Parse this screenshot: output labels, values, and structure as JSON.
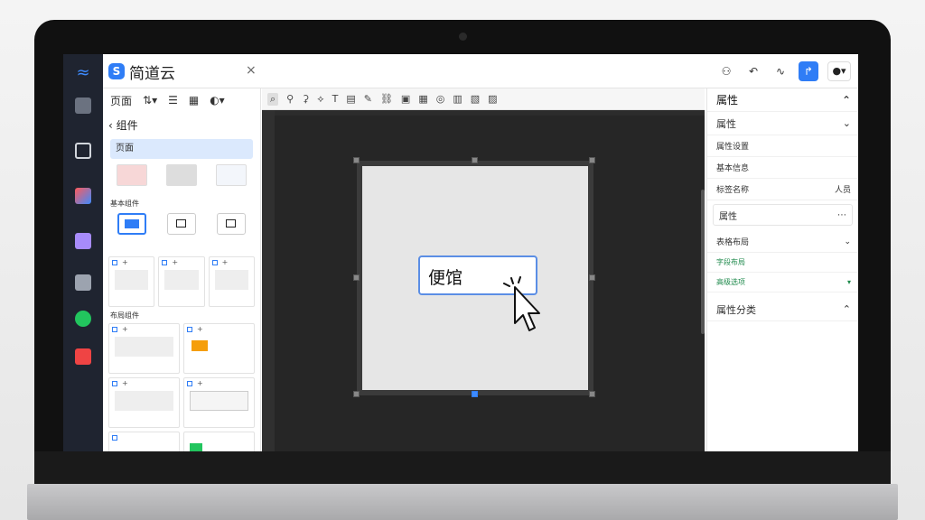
{
  "app": {
    "brand_name": "简道云",
    "tab_close": "×"
  },
  "canvas": {
    "widget_label": "便馆"
  },
  "right_panel": {
    "header": "属性",
    "select_value": "属性",
    "rows": [
      {
        "label": "属性设置"
      },
      {
        "label": "基本信息"
      }
    ],
    "field_label_left": "标签名称",
    "field_label_right": "人员",
    "field_value": "属性",
    "section_label": "表格布局",
    "green_items": [
      "字段布局",
      "高级选项"
    ],
    "footer_label": "属性分类"
  },
  "left_panel": {
    "header_label": "页面",
    "back_label": "组件",
    "selected_item": "页面",
    "section_1": "基本组件",
    "section_2": "布局组件"
  },
  "colors": {
    "accent": "#2f7df6",
    "canvas_bg": "#262626",
    "selection_bg": "#dbe9fd",
    "green": "#1f8a4c"
  },
  "icons": {
    "rail": [
      "logo-icon",
      "app-icon",
      "form-icon",
      "flow-icon",
      "data-icon",
      "member-icon",
      "check-icon",
      "file-icon"
    ],
    "toolbar": [
      "search-icon",
      "move-icon",
      "align-icon",
      "transform-icon",
      "text-icon",
      "doc-icon",
      "pen-icon",
      "link-icon",
      "image-icon",
      "grid-icon",
      "target-icon"
    ]
  }
}
